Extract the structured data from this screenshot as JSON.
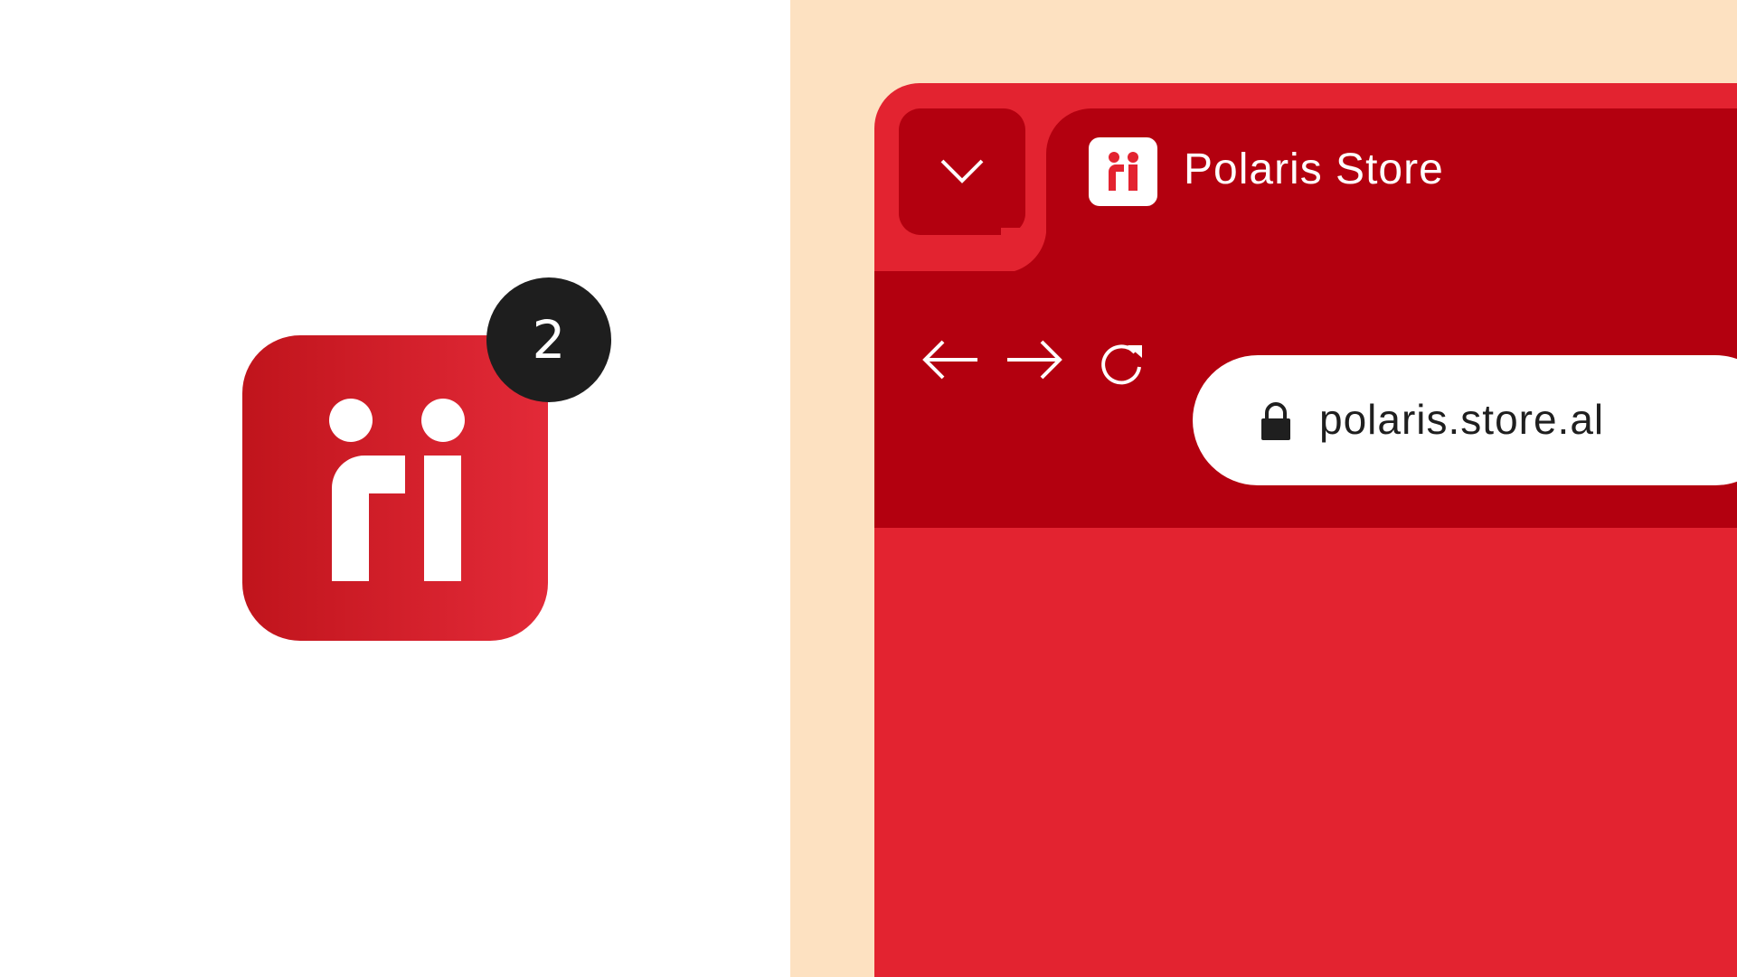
{
  "app_icon": {
    "icon": "ri-logo-icon",
    "brand_color": "#e32330",
    "notification_badge": "2"
  },
  "browser": {
    "tab_toggle_icon": "chevron-down-icon",
    "tab": {
      "favicon": "ri-logo-icon",
      "title": "Polaris Store"
    },
    "toolbar": {
      "back_icon": "arrow-left-icon",
      "forward_icon": "arrow-right-icon",
      "reload_icon": "reload-icon"
    },
    "address_bar": {
      "lock_icon": "lock-icon",
      "url": "polaris.store.al"
    }
  },
  "colors": {
    "backdrop": "#fde1c1",
    "browser_chrome": "#b3000f",
    "browser_content": "#e32330",
    "badge": "#1e1e1e"
  }
}
